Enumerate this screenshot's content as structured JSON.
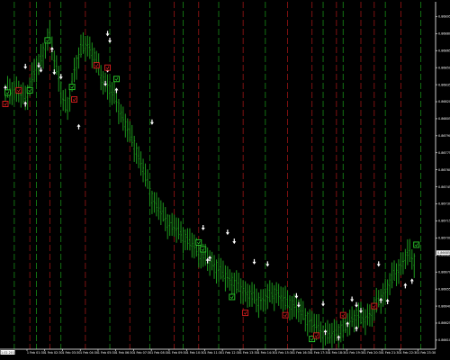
{
  "chart_data": {
    "type": "candlestick",
    "title": "",
    "xlabel": "",
    "ylabel": "",
    "grid": false,
    "colors": {
      "background": "#000000",
      "axis": "#ffffff",
      "bar": "#1d9a1d",
      "green_session_line": "#178c17",
      "red_session_line": "#9c1515",
      "buy_marker": "#2cd22c",
      "sell_marker": "#e02020",
      "arrow": "#ffffff"
    },
    "y_ticks": [
      "0.86895",
      "0.86880",
      "0.86865",
      "0.86850",
      "0.86835",
      "0.86820",
      "0.86805",
      "0.86790",
      "0.86775",
      "0.86760",
      "0.86745",
      "0.86730",
      "0.86715",
      "0.86700",
      "0.86685",
      "0.86670",
      "0.86655",
      "0.86640",
      "0.86625",
      "0.86610"
    ],
    "ylim": [
      0.86602,
      0.86908
    ],
    "current_price": "0.86685",
    "current_price_value": 0.86687,
    "x_ticks": [
      "1 Feb 01:30",
      "1 Feb 02:30",
      "1 Feb 03:30",
      "1 Feb 04:30",
      "1 Feb 05:30",
      "1 Feb 06:30",
      "1 Feb 07:30",
      "1 Feb 08:30",
      "1 Feb 09:30",
      "1 Feb 10:30",
      "1 Feb 11:30",
      "1 Feb 12:30",
      "1 Feb 13:30",
      "1 Feb 14:30",
      "1 Feb 15:30",
      "1 Feb 16:30",
      "1 Feb 17:30",
      "1 Feb 18:30",
      "1 Feb 19:30",
      "1 Feb 20:30",
      "1 Feb 21:30",
      "1 Feb 22:30",
      "1 Feb 23:30"
    ],
    "first_time_label": "1.02.2011 00:00",
    "price_path": [
      [
        0,
        0.86826
      ],
      [
        3,
        0.86832
      ],
      [
        6,
        0.86828
      ],
      [
        9,
        0.86822
      ],
      [
        12,
        0.86842
      ],
      [
        15,
        0.86852
      ],
      [
        18,
        0.8687
      ],
      [
        20,
        0.86878
      ],
      [
        22,
        0.86856
      ],
      [
        24,
        0.86842
      ],
      [
        26,
        0.86822
      ],
      [
        28,
        0.86812
      ],
      [
        31,
        0.86848
      ],
      [
        34,
        0.86866
      ],
      [
        37,
        0.8687
      ],
      [
        40,
        0.8686
      ],
      [
        43,
        0.86842
      ],
      [
        46,
        0.86834
      ],
      [
        50,
        0.8682
      ],
      [
        54,
        0.868
      ],
      [
        58,
        0.86782
      ],
      [
        62,
        0.8676
      ],
      [
        66,
        0.86735
      ],
      [
        70,
        0.86722
      ],
      [
        74,
        0.86712
      ],
      [
        78,
        0.86706
      ],
      [
        82,
        0.86698
      ],
      [
        86,
        0.8669
      ],
      [
        90,
        0.86682
      ],
      [
        94,
        0.86676
      ],
      [
        98,
        0.86668
      ],
      [
        102,
        0.86662
      ],
      [
        106,
        0.86655
      ],
      [
        110,
        0.8665
      ],
      [
        114,
        0.86644
      ],
      [
        118,
        0.86648
      ],
      [
        122,
        0.86652
      ],
      [
        126,
        0.86644
      ],
      [
        130,
        0.8664
      ],
      [
        134,
        0.86632
      ],
      [
        138,
        0.86625
      ],
      [
        142,
        0.86618
      ],
      [
        146,
        0.86614
      ],
      [
        150,
        0.86618
      ],
      [
        154,
        0.86624
      ],
      [
        158,
        0.86632
      ],
      [
        162,
        0.86628
      ],
      [
        166,
        0.86638
      ],
      [
        170,
        0.8665
      ],
      [
        174,
        0.86664
      ],
      [
        178,
        0.86676
      ],
      [
        181,
        0.86686
      ],
      [
        184,
        0.8668
      ]
    ],
    "signals": [
      {
        "type": "buy",
        "bar": 1,
        "price": 0.86828
      },
      {
        "type": "sell",
        "bar": 0,
        "price": 0.86818
      },
      {
        "type": "sell",
        "bar": 6,
        "price": 0.8683
      },
      {
        "type": "buy",
        "bar": 11,
        "price": 0.8683
      },
      {
        "type": "buy",
        "bar": 19,
        "price": 0.86874
      },
      {
        "type": "buy",
        "bar": 30,
        "price": 0.86833
      },
      {
        "type": "sell",
        "bar": 31,
        "price": 0.86822
      },
      {
        "type": "sell",
        "bar": 41,
        "price": 0.86852
      },
      {
        "type": "sell",
        "bar": 46,
        "price": 0.8685
      },
      {
        "type": "buy",
        "bar": 50,
        "price": 0.8684
      },
      {
        "type": "buy",
        "bar": 87,
        "price": 0.86696
      },
      {
        "type": "buy",
        "bar": 89,
        "price": 0.8669
      },
      {
        "type": "buy",
        "bar": 102,
        "price": 0.86648
      },
      {
        "type": "sell",
        "bar": 108,
        "price": 0.86634
      },
      {
        "type": "sell",
        "bar": 126,
        "price": 0.86632
      },
      {
        "type": "buy",
        "bar": 138,
        "price": 0.86611
      },
      {
        "type": "sell",
        "bar": 140,
        "price": 0.86614
      },
      {
        "type": "sell",
        "bar": 152,
        "price": 0.86632
      },
      {
        "type": "sell",
        "bar": 166,
        "price": 0.8664
      },
      {
        "type": "buy",
        "bar": 185,
        "price": 0.86694
      }
    ],
    "arrows": [
      {
        "dir": "up",
        "bar": 0,
        "price": 0.86832
      },
      {
        "dir": "down",
        "bar": 9,
        "price": 0.86851
      },
      {
        "dir": "up",
        "bar": 9,
        "price": 0.86818
      },
      {
        "dir": "down",
        "bar": 15,
        "price": 0.86852
      },
      {
        "dir": "down",
        "bar": 16,
        "price": 0.86848
      },
      {
        "dir": "up",
        "bar": 21,
        "price": 0.86866
      },
      {
        "dir": "down",
        "bar": 22,
        "price": 0.86846
      },
      {
        "dir": "down",
        "bar": 25,
        "price": 0.86842
      },
      {
        "dir": "up",
        "bar": 33,
        "price": 0.86798
      },
      {
        "dir": "down",
        "bar": 46,
        "price": 0.8688
      },
      {
        "dir": "down",
        "bar": 47,
        "price": 0.86874
      },
      {
        "dir": "down",
        "bar": 45,
        "price": 0.86836
      },
      {
        "dir": "down",
        "bar": 46,
        "price": 0.86848
      },
      {
        "dir": "up",
        "bar": 50,
        "price": 0.8683
      },
      {
        "dir": "down",
        "bar": 66,
        "price": 0.86802
      },
      {
        "dir": "down",
        "bar": 89,
        "price": 0.86709
      },
      {
        "dir": "down",
        "bar": 100,
        "price": 0.86705
      },
      {
        "dir": "up",
        "bar": 91,
        "price": 0.8668
      },
      {
        "dir": "up",
        "bar": 92,
        "price": 0.86682
      },
      {
        "dir": "down",
        "bar": 103,
        "price": 0.86697
      },
      {
        "dir": "down",
        "bar": 112,
        "price": 0.86679
      },
      {
        "dir": "down",
        "bar": 118,
        "price": 0.86677
      },
      {
        "dir": "down",
        "bar": 131,
        "price": 0.86649
      },
      {
        "dir": "down",
        "bar": 132,
        "price": 0.86641
      },
      {
        "dir": "down",
        "bar": 143,
        "price": 0.86642
      },
      {
        "dir": "down",
        "bar": 156,
        "price": 0.86646
      },
      {
        "dir": "down",
        "bar": 158,
        "price": 0.86641
      },
      {
        "dir": "down",
        "bar": 160,
        "price": 0.86636
      },
      {
        "dir": "up",
        "bar": 144,
        "price": 0.86617
      },
      {
        "dir": "up",
        "bar": 150,
        "price": 0.86612
      },
      {
        "dir": "up",
        "bar": 154,
        "price": 0.86624
      },
      {
        "dir": "up",
        "bar": 158,
        "price": 0.8662
      },
      {
        "dir": "down",
        "bar": 168,
        "price": 0.86677
      },
      {
        "dir": "up",
        "bar": 169,
        "price": 0.86645
      },
      {
        "dir": "up",
        "bar": 172,
        "price": 0.86644
      },
      {
        "dir": "up",
        "bar": 180,
        "price": 0.86658
      },
      {
        "dir": "up",
        "bar": 183,
        "price": 0.86662
      }
    ],
    "session_lines": [
      {
        "bar": 4,
        "color": "green"
      },
      {
        "bar": 11,
        "color": "red"
      },
      {
        "bar": 14,
        "color": "green"
      },
      {
        "bar": 20,
        "color": "red"
      },
      {
        "bar": 25,
        "color": "green"
      },
      {
        "bar": 36,
        "color": "red"
      },
      {
        "bar": 47,
        "color": "green"
      },
      {
        "bar": 56,
        "color": "red"
      },
      {
        "bar": 65,
        "color": "green"
      },
      {
        "bar": 76,
        "color": "red"
      },
      {
        "bar": 80,
        "color": "green"
      },
      {
        "bar": 87,
        "color": "red"
      },
      {
        "bar": 96,
        "color": "green"
      },
      {
        "bar": 107,
        "color": "red"
      },
      {
        "bar": 117,
        "color": "green"
      },
      {
        "bar": 127,
        "color": "red"
      },
      {
        "bar": 138,
        "color": "red"
      },
      {
        "bar": 143,
        "color": "green"
      },
      {
        "bar": 149,
        "color": "red"
      },
      {
        "bar": 152,
        "color": "green"
      },
      {
        "bar": 160,
        "color": "red"
      },
      {
        "bar": 166,
        "color": "red"
      },
      {
        "bar": 171,
        "color": "green"
      },
      {
        "bar": 178,
        "color": "red"
      },
      {
        "bar": 187,
        "color": "green"
      }
    ]
  }
}
